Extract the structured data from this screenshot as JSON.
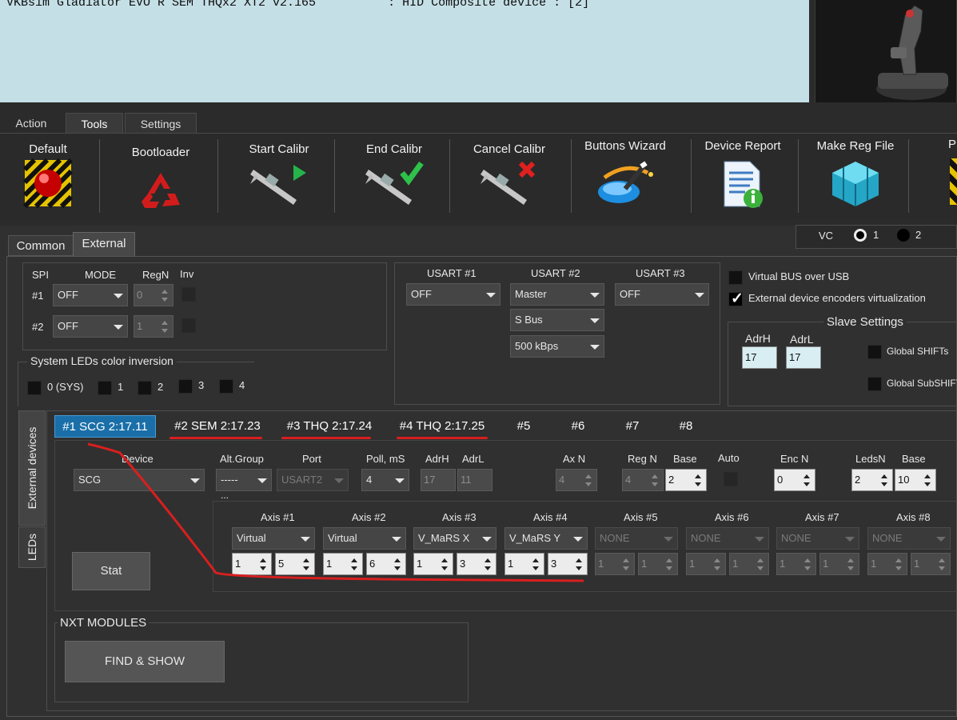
{
  "device_list": {
    "row": "VKBsim Gladiator EVO R SEM THQx2 XT2 v2.165          : HID Composite device : [2]"
  },
  "top_tabs": [
    {
      "label": "Action"
    },
    {
      "label": "Tools"
    },
    {
      "label": "Settings"
    }
  ],
  "toolbar": {
    "default": "Default",
    "bootloader": "Bootloader",
    "start_calibr": "Start Calibr",
    "end_calibr": "End Calibr",
    "cancel_calibr": "Cancel Calibr",
    "buttons_wizard": "Buttons Wizard",
    "device_report": "Device Report",
    "make_reg_file": "Make Reg File",
    "partial": "P"
  },
  "sub_tabs": {
    "common": "Common",
    "external": "External"
  },
  "vc": {
    "label": "VC",
    "opt1": "1",
    "opt2": "2"
  },
  "spi": {
    "h_spi": "SPI",
    "h_mode": "MODE",
    "h_regn": "RegN",
    "h_inv": "Inv",
    "rows": [
      {
        "label": "#1",
        "mode": "OFF",
        "regn": "0"
      },
      {
        "label": "#2",
        "mode": "OFF",
        "regn": "1"
      }
    ]
  },
  "leds_inv": {
    "title": "System LEDs color inversion",
    "items": [
      "0 (SYS)",
      "1",
      "2",
      "3",
      "4"
    ]
  },
  "usart": {
    "h1": "USART #1",
    "h2": "USART #2",
    "h3": "USART #3",
    "u1": "OFF",
    "u2_mode": "Master",
    "u2_proto": "S Bus",
    "u2_speed": "500 kBps",
    "u3": "OFF"
  },
  "virtual": {
    "vbus": "Virtual BUS over USB",
    "ext_enc": "External device encoders virtualization",
    "slave_title": "Slave Settings",
    "adrh_label": "AdrH",
    "adrh": "17",
    "adrl_label": "AdrL",
    "adrl": "17",
    "global_shift": "Global SHIFTs",
    "global_subshift": "Global SubSHIFTs"
  },
  "side_tabs": {
    "external_devices": "External devices",
    "leds": "LEDs"
  },
  "ext_tabs": [
    "#1 SCG 2:17.11",
    "#2 SEM 2:17.23",
    "#3 THQ 2:17.24",
    "#4 THQ 2:17.25",
    "#5",
    "#6",
    "#7",
    "#8"
  ],
  "device_cfg": {
    "h_device": "Device",
    "h_altgroup": "Alt.Group",
    "h_port": "Port",
    "h_poll": "Poll, mS",
    "h_adrh": "AdrH",
    "h_adrl": "AdrL",
    "h_axn": "Ax N",
    "h_regn": "Reg N",
    "h_base": "Base",
    "h_auto": "Auto",
    "h_encn": "Enc N",
    "h_ledsn": "LedsN",
    "h_base2": "Base",
    "device": "SCG",
    "altgroup": "-----",
    "port": "USART2",
    "poll": "4",
    "adrh": "17",
    "adrl": "11",
    "axn": "4",
    "regn": "4",
    "base": "2",
    "encn": "0",
    "ledsn": "2",
    "base2": "10",
    "dots": "..."
  },
  "axes": [
    {
      "label": "Axis #1",
      "type": "Virtual",
      "a": "1",
      "b": "5"
    },
    {
      "label": "Axis #2",
      "type": "Virtual",
      "a": "1",
      "b": "6"
    },
    {
      "label": "Axis #3",
      "type": "V_MaRS X",
      "a": "1",
      "b": "3"
    },
    {
      "label": "Axis #4",
      "type": "V_MaRS Y",
      "a": "1",
      "b": "3"
    },
    {
      "label": "Axis #5",
      "type": "NONE",
      "a": "1",
      "b": "1"
    },
    {
      "label": "Axis #6",
      "type": "NONE",
      "a": "1",
      "b": "1"
    },
    {
      "label": "Axis #7",
      "type": "NONE",
      "a": "1",
      "b": "1"
    },
    {
      "label": "Axis #8",
      "type": "NONE",
      "a": "1",
      "b": "1"
    }
  ],
  "stat_button": "Stat",
  "nxt": {
    "title": "NXT MODULES",
    "button": "FIND &  SHOW"
  },
  "colors": {
    "selected_tab": "#1a6fa8",
    "annotation": "#d81f1f",
    "device_list_bg": "#c5dfe6"
  }
}
